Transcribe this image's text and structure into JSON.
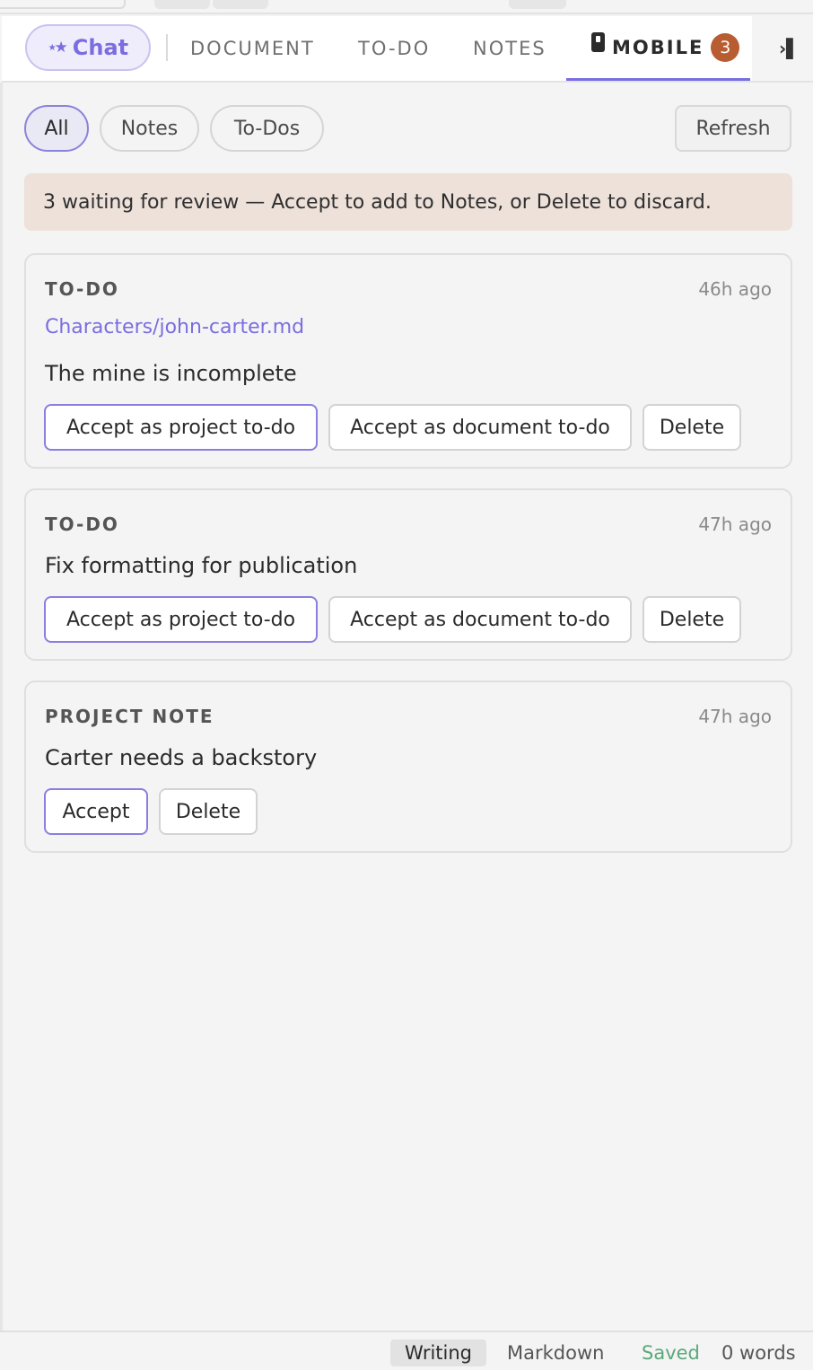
{
  "tabs": {
    "chat_label": "Chat",
    "items": [
      "DOCUMENT",
      "TO-DO",
      "NOTES",
      "MOBILE"
    ],
    "active": "MOBILE",
    "mobile_badge": "3"
  },
  "filters": {
    "items": [
      "All",
      "Notes",
      "To-Dos"
    ],
    "active": "All",
    "refresh_label": "Refresh"
  },
  "banner": {
    "text": "3 waiting for review — Accept to add to Notes, or Delete to discard."
  },
  "cards": [
    {
      "kind": "TO-DO",
      "time": "46h ago",
      "link": "Characters/john-carter.md",
      "text": "The mine is incomplete",
      "buttons": [
        "Accept as project to-do",
        "Accept as document to-do",
        "Delete"
      ]
    },
    {
      "kind": "TO-DO",
      "time": "47h ago",
      "text": "Fix formatting for publication",
      "buttons": [
        "Accept as project to-do",
        "Accept as document to-do",
        "Delete"
      ]
    },
    {
      "kind": "PROJECT NOTE",
      "time": "47h ago",
      "text": "Carter needs a backstory",
      "buttons": [
        "Accept",
        "Delete"
      ]
    }
  ],
  "status": {
    "modes": [
      "Writing",
      "Markdown"
    ],
    "active_mode": "Writing",
    "saved": "Saved",
    "word_count": "0 words"
  },
  "colors": {
    "accent": "#7a6de0",
    "badge": "#b85c32",
    "banner_bg": "#ede1da",
    "saved": "#5aa97a"
  },
  "icons": [
    "sparkle-icon",
    "phone-icon",
    "collapse-panel-icon"
  ]
}
